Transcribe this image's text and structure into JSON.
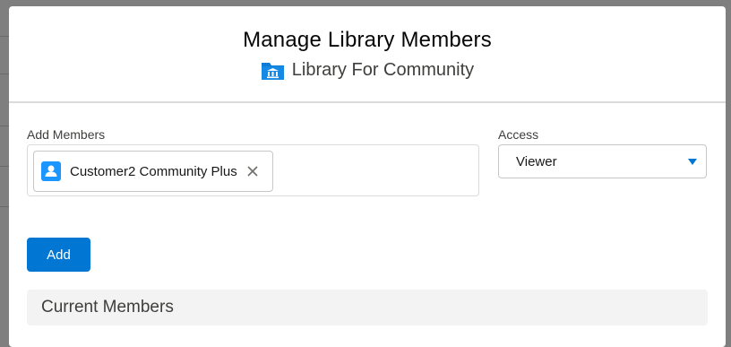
{
  "modal": {
    "title": "Manage Library Members",
    "library_name": "Library For Community"
  },
  "form": {
    "members_label": "Add Members",
    "selected_members": [
      {
        "name": "Customer2 Community Plus",
        "icon": "user-icon"
      }
    ],
    "access_label": "Access",
    "access_value": "Viewer",
    "add_button_label": "Add"
  },
  "current_members": {
    "heading": "Current Members"
  },
  "colors": {
    "brand": "#0176d3",
    "user_avatar": "#1b96ff",
    "library_icon": "#0c7bd6"
  }
}
